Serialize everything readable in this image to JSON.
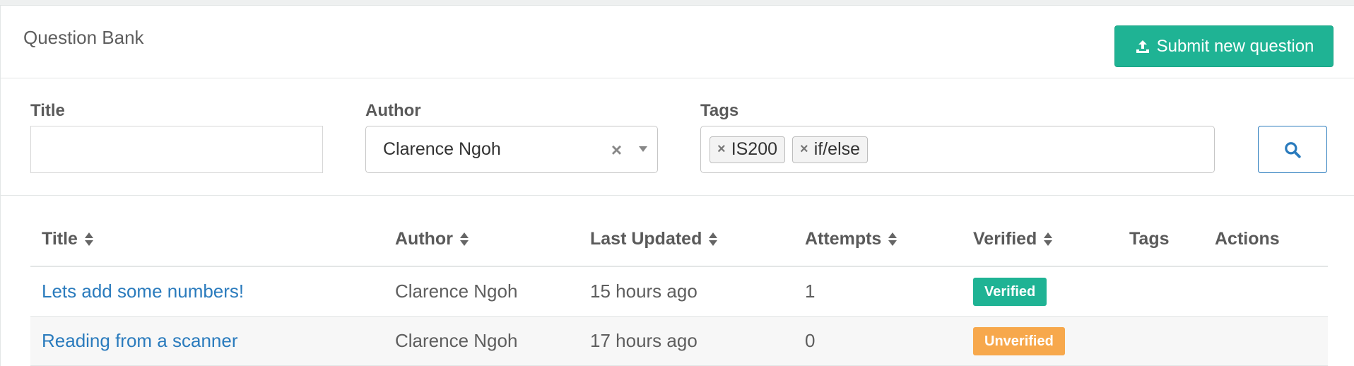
{
  "header": {
    "title": "Question Bank",
    "submit_label": "Submit new question",
    "submit_icon": "upload-icon"
  },
  "filters": {
    "title_label": "Title",
    "title_value": "",
    "author_label": "Author",
    "author_value": "Clarence Ngoh",
    "clear_glyph": "×",
    "tags_label": "Tags",
    "tags": [
      {
        "label": "IS200",
        "remove": "×"
      },
      {
        "label": "if/else",
        "remove": "×"
      }
    ],
    "search_icon": "search-icon"
  },
  "table": {
    "columns": [
      "Title",
      "Author",
      "Last Updated",
      "Attempts",
      "Verified",
      "Tags",
      "Actions"
    ],
    "rows": [
      {
        "title": "Lets add some numbers!",
        "author": "Clarence Ngoh",
        "updated": "15 hours ago",
        "attempts": "1",
        "verified": "Verified",
        "tags": "",
        "actions": ""
      },
      {
        "title": "Reading from a scanner",
        "author": "Clarence Ngoh",
        "updated": "17 hours ago",
        "attempts": "0",
        "verified": "Unverified",
        "tags": "",
        "actions": ""
      }
    ]
  },
  "colors": {
    "accent_green": "#1fb394",
    "link_blue": "#2a7bbd",
    "warning_orange": "#f7a84c"
  }
}
